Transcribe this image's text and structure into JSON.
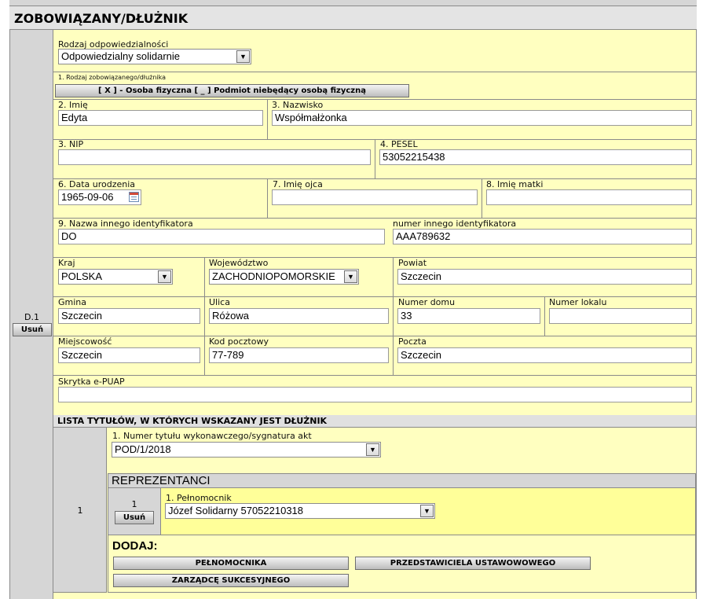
{
  "section": {
    "title": "ZOBOWIĄZANY/DŁUŻNIK",
    "row_label": "D.1",
    "remove_label": "Usuń"
  },
  "responsibility": {
    "label": "Rodzaj odpowiedzialności",
    "value": "Odpowiedzialny solidarnie"
  },
  "debtor_type": {
    "label": "1. Rodzaj zobowiązanego/dłużnika",
    "button": "[ X ] - Osoba fizyczna [ _ ] Podmiot niebędący osobą fizyczną"
  },
  "fields": {
    "first_name": {
      "label": "2. Imię",
      "value": "Edyta"
    },
    "last_name": {
      "label": "3. Nazwisko",
      "value": "Współmałżonka"
    },
    "nip": {
      "label": "3. NIP",
      "value": ""
    },
    "pesel": {
      "label": "4. PESEL",
      "value": "53052215438"
    },
    "birth_date": {
      "label": "6. Data urodzenia",
      "value": "1965-09-06"
    },
    "father_name": {
      "label": "7. Imię ojca",
      "value": ""
    },
    "mother_name": {
      "label": "8. Imię matki",
      "value": ""
    },
    "other_id_name": {
      "label": "9. Nazwa innego identyfikatora",
      "value": "DO"
    },
    "other_id_number": {
      "label": "numer innego identyfikatora",
      "value": "AAA789632"
    },
    "country": {
      "label": "Kraj",
      "value": "POLSKA"
    },
    "voivodeship": {
      "label": "Województwo",
      "value": "ZACHODNIOPOMORSKIE"
    },
    "county": {
      "label": "Powiat",
      "value": "Szczecin"
    },
    "commune": {
      "label": "Gmina",
      "value": "Szczecin"
    },
    "street": {
      "label": "Ulica",
      "value": "Różowa"
    },
    "house_no": {
      "label": "Numer domu",
      "value": "33"
    },
    "flat_no": {
      "label": "Numer lokalu",
      "value": ""
    },
    "city": {
      "label": "Miejscowość",
      "value": "Szczecin"
    },
    "postal_code": {
      "label": "Kod pocztowy",
      "value": "77-789"
    },
    "post_office": {
      "label": "Poczta",
      "value": "Szczecin"
    },
    "epuap": {
      "label": "Skrytka e-PUAP",
      "value": ""
    }
  },
  "titles": {
    "header": "LISTA TYTUŁÓW, W KTÓRYCH WSKAZANY JEST DŁUŻNIK",
    "row_number": "1",
    "title_label": "1. Numer tytułu wykonawczego/sygnatura akt",
    "title_value": "POD/1/2018",
    "representatives": {
      "header": "REPREZENTANCI",
      "row_number": "1",
      "remove_label": "Usuń",
      "attorney_label": "1. Pełnomocnik",
      "attorney_value": "Józef Solidarny 57052210318"
    },
    "add": {
      "label": "DODAJ:",
      "attorney_button": "PEŁNOMOCNIKA",
      "statutory_button": "PRZEDSTAWICIELA USTAWOWOWEGO",
      "successor_button": "ZARZĄDCĘ SUKCESYJNEGO"
    }
  },
  "icons": {
    "dropdown": "▼",
    "calendar": "calendar-icon"
  },
  "colors": {
    "field_bg": "#ffffc0",
    "side_bg": "#d6d6d6"
  }
}
